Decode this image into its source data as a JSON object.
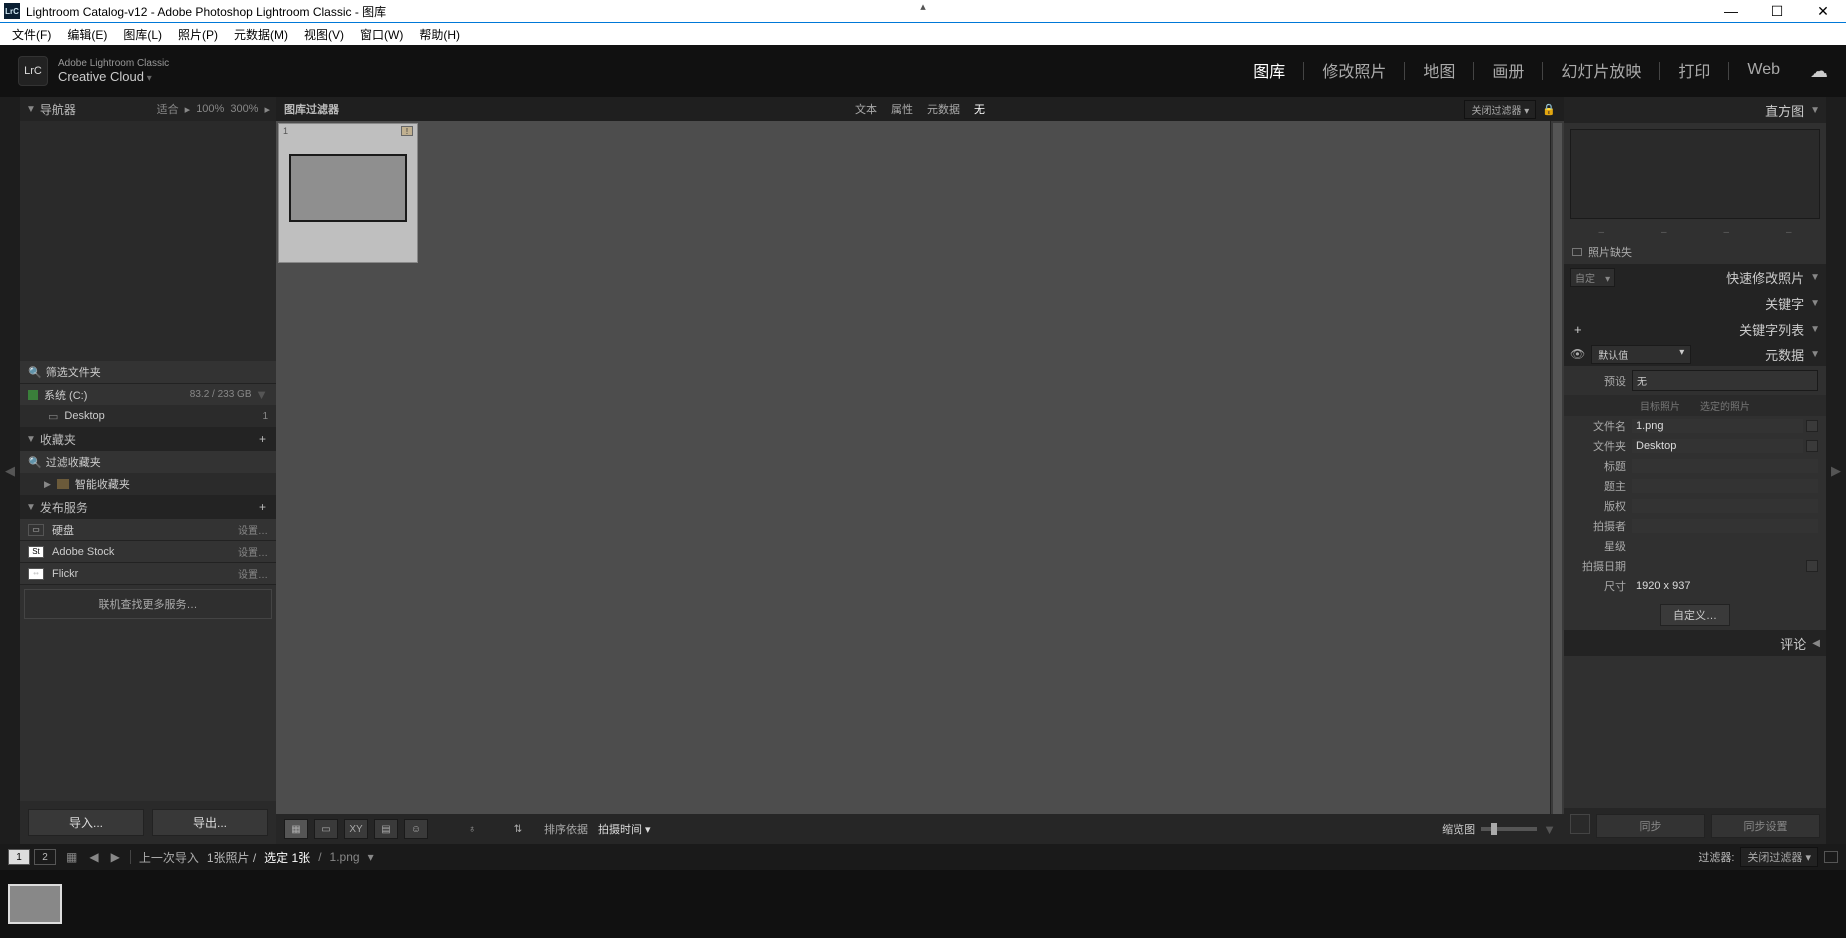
{
  "window": {
    "title": "Lightroom Catalog-v12 - Adobe Photoshop Lightroom Classic - 图库"
  },
  "menubar": [
    "文件(F)",
    "编辑(E)",
    "图库(L)",
    "照片(P)",
    "元数据(M)",
    "视图(V)",
    "窗口(W)",
    "帮助(H)"
  ],
  "brand": {
    "line1": "Adobe Lightroom Classic",
    "line2": "Creative Cloud"
  },
  "modules": [
    "图库",
    "修改照片",
    "地图",
    "画册",
    "幻灯片放映",
    "打印",
    "Web"
  ],
  "active_module": "图库",
  "left": {
    "navigator": {
      "title": "导航器",
      "zoom_opts": [
        "适合",
        "100%",
        "300%"
      ]
    },
    "folders": {
      "filter_label": "筛选文件夹",
      "drive": {
        "name": "系统 (C:)",
        "space": "83.2 / 233 GB"
      },
      "items": [
        {
          "name": "Desktop",
          "count": "1"
        }
      ]
    },
    "collections": {
      "title": "收藏夹",
      "filter_label": "过滤收藏夹",
      "smart": "智能收藏夹"
    },
    "publish": {
      "title": "发布服务",
      "services": [
        {
          "name": "硬盘",
          "setup": "设置…"
        },
        {
          "name": "Adobe Stock",
          "setup": "设置…"
        },
        {
          "name": "Flickr",
          "setup": "设置…"
        }
      ],
      "find_more": "联机查找更多服务…"
    },
    "btn_import": "导入...",
    "btn_export": "导出..."
  },
  "filter": {
    "title": "图库过滤器",
    "tabs": [
      "文本",
      "属性",
      "元数据",
      "无"
    ],
    "active": "无",
    "off_label": "关闭过滤器"
  },
  "grid": {
    "thumb_index": "1"
  },
  "toolbar": {
    "sort_label": "排序依据",
    "sort_value": "拍摄时间",
    "thumb_label": "缩览图"
  },
  "right": {
    "histogram": {
      "title": "直方图",
      "missing": "照片缺失"
    },
    "quick_dev": {
      "title": "快速修改照片",
      "preset_label": "自定"
    },
    "keywording": {
      "title": "关键字"
    },
    "keyword_list": {
      "title": "关键字列表"
    },
    "metadata": {
      "title": "元数据",
      "default": "默认值",
      "preset_label": "预设",
      "preset_value": "无",
      "tabs": [
        "目标照片",
        "选定的照片"
      ],
      "rows": [
        {
          "label": "文件名",
          "value": "1.png"
        },
        {
          "label": "文件夹",
          "value": "Desktop"
        },
        {
          "label": "标题",
          "value": ""
        },
        {
          "label": "题主",
          "value": ""
        },
        {
          "label": "版权",
          "value": ""
        },
        {
          "label": "拍摄者",
          "value": ""
        },
        {
          "label": "星级",
          "value": ""
        },
        {
          "label": "拍摄日期",
          "value": ""
        },
        {
          "label": "尺寸",
          "value": "1920 x 937"
        }
      ],
      "custom_btn": "自定义…"
    },
    "comments": {
      "title": "评论"
    },
    "sync_btn": "同步",
    "sync_settings_btn": "同步设置"
  },
  "status": {
    "last_import": "上一次导入",
    "count_text": "1张照片 /",
    "selected": "选定 1张",
    "filename": "1.png",
    "filter_label": "过滤器:",
    "filter_value": "关闭过滤器"
  }
}
